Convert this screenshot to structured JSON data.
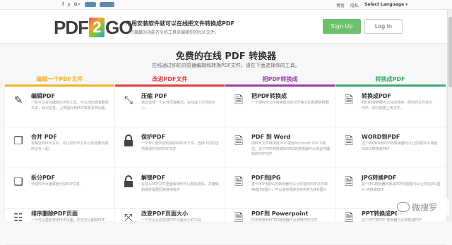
{
  "topbar": {
    "social": [
      "f",
      "y",
      "G+"
    ],
    "share_label": "分享",
    "count": "1 536",
    "links": [
      "博客",
      "隐私"
    ],
    "language": "Select Language ▾"
  },
  "header": {
    "logo_left": "PDF",
    "logo_mid": "2",
    "logo_right": "GO",
    "logo_dotcom": ".com",
    "tagline": "不用安装软件就可以在线把文件转换成PDF",
    "subtag": "一个简单的功能齐全的工具来编辑你的PDF文件。",
    "signup": "Sign Up",
    "login": "Log In"
  },
  "hero": {
    "title": "免费的在线 PDF 转换器",
    "sub": "在线通过你的浏览器编辑和转换PDF文件。请在下面选择你的工具。"
  },
  "columns": [
    {
      "head": "编辑一个PDF文件",
      "color": "#f3b120",
      "cards": [
        {
          "icon": "edit-icon",
          "title": "编辑PDF",
          "desc": "一款可以在线编辑PDF的工具，可以增加或者删除文本，标记信息，上传图片到PDF等等多种功能。"
        },
        {
          "icon": "merge-icon",
          "title": "合并 PDF",
          "desc": "将相近的PDF文件，可以把PDF文件以你想要的顺序合在一起。"
        },
        {
          "icon": "split-icon",
          "title": "拆分PDF",
          "desc": "分割PDF页面或者分割PDF文件"
        },
        {
          "icon": "reorder-icon",
          "title": "排序删除PDF页面",
          "desc": "一个可以重新排序PDF页面，你也可以删除PDF"
        }
      ]
    },
    {
      "head": "改进PDF文件",
      "color": "#e03c3c",
      "cards": [
        {
          "icon": "compress-icon",
          "title": "压缩 PDF",
          "desc": "通过选择一个文件压缩格式，在线减少文件的大小。"
        },
        {
          "icon": "lock-icon",
          "title": "保护PDF",
          "desc": "一个专门受到密码保护的PDF文件，选择不同的选项来保护你的PDF文件"
        },
        {
          "icon": "unlock-icon",
          "title": "解锁PDF",
          "desc": "在线从PDF文件里面解锁你可以删除密码，并编辑和保存需要回来继续操作"
        },
        {
          "icon": "resize-icon",
          "title": "改变PDF页面大小",
          "desc": "一个可以让你改变PDF页面大小的工具"
        }
      ]
    },
    {
      "head": "把PDF转换成",
      "color": "#9b3aa6",
      "cards": [
        {
          "icon": "convert-from-icon",
          "title": "把PDF转换成",
          "desc": "一个把PDF文件转换成你的文件格式的数据转换器"
        },
        {
          "icon": "pdf-to-word-icon",
          "title": "PDF 到 Word",
          "desc": "把PDF文件转换成DOC或者Microsoft DOCX格式。这个PDF转换成WORD的转换器可以保证你编辑的PDF文件"
        },
        {
          "icon": "pdf-to-jpg-icon",
          "title": "PDF到JPG",
          "desc": "这个PDF到JPG的转换器可以让你把的PDF文件转换成JPG图片，可以使你保存你的PDF为JPG图片"
        },
        {
          "icon": "pdf-to-ppt-icon",
          "title": "PDF到 Powerpoint",
          "desc": "PDF转换到PPT的转换器可以转换PDF文件"
        }
      ]
    },
    {
      "head": "转换成PDF",
      "color": "#3aa86b",
      "cards": [
        {
          "icon": "convert-to-icon",
          "title": "转换成PDF",
          "desc": "我们的转换器可以在线转换，把你的文件变为PDF，你只需要上传文件。"
        },
        {
          "icon": "word-to-pdf-icon",
          "title": "WORD到PDF",
          "desc": "这个WORD到PDF的转换器可以让你把DOC或者DOCX转换成PDF"
        },
        {
          "icon": "jpg-to-pdf-icon",
          "title": "JPG转换PDF",
          "desc": "这个JPG转换器转换成PDF的图像可以让你的JPG图片 转换成PDF"
        },
        {
          "icon": "ppt-to-pdf-icon",
          "title": "PPT转换成PDF",
          "desc": "这个PPT到PDF 转换器可以转换成PDF"
        }
      ]
    }
  ],
  "watermark": "微搜罗"
}
